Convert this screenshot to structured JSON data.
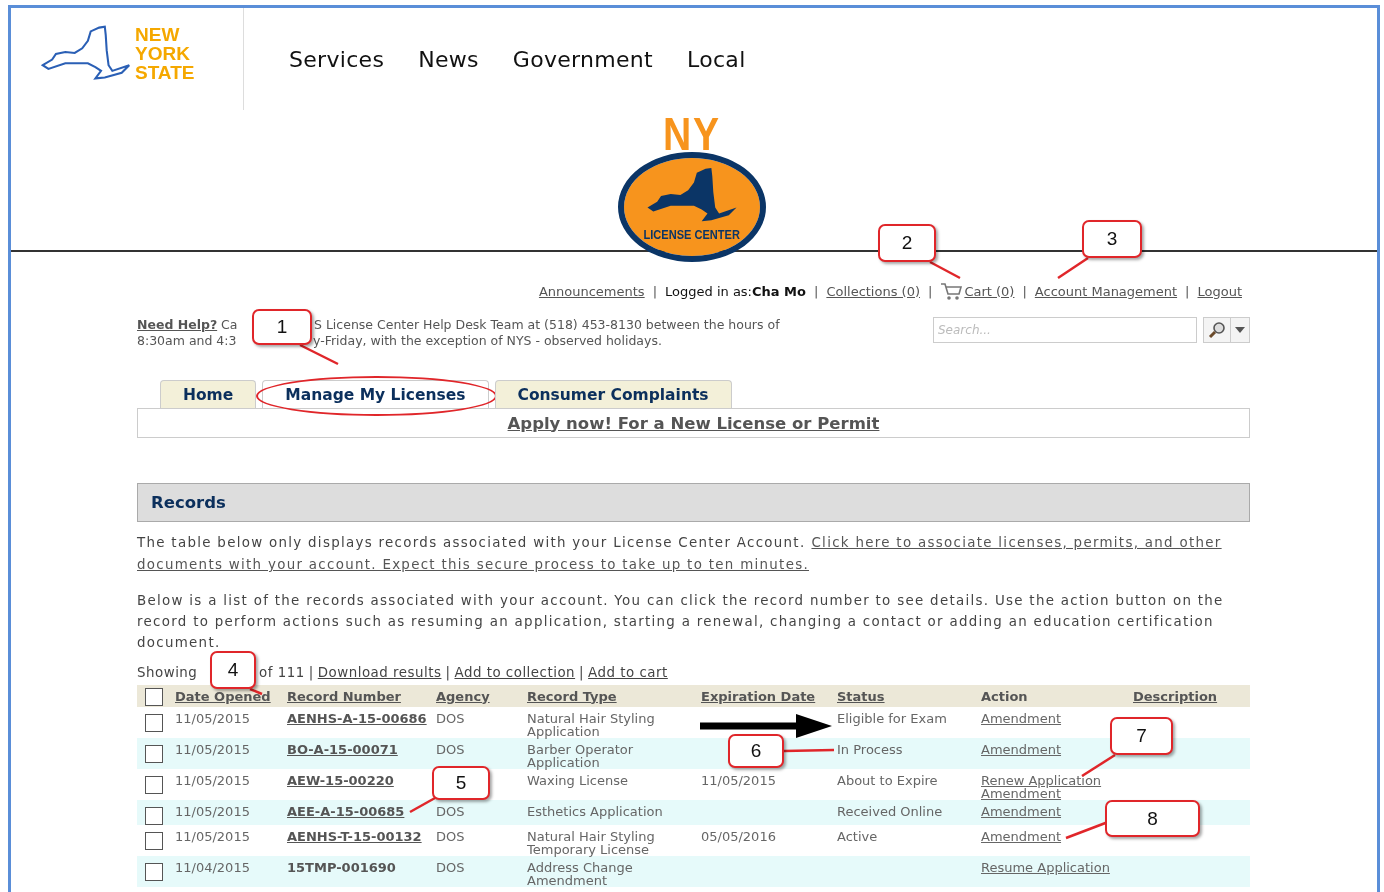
{
  "header": {
    "logo_text": [
      "NEW",
      "YORK",
      "STATE"
    ],
    "nav": [
      {
        "label": "Services"
      },
      {
        "label": "News"
      },
      {
        "label": "Government"
      },
      {
        "label": "Local"
      }
    ]
  },
  "banner": {
    "logo_top": "NY",
    "logo_bottom": "LICENSE CENTER"
  },
  "top_links": [
    {
      "kind": "link",
      "label": "Announcements"
    },
    {
      "kind": "user",
      "prefix": "Logged in as:",
      "name": "Cha Mo"
    },
    {
      "kind": "link",
      "label": "Collections (0)"
    },
    {
      "kind": "cart",
      "label": "Cart (0)"
    },
    {
      "kind": "link",
      "label": "Account Management"
    },
    {
      "kind": "link",
      "label": "Logout"
    }
  ],
  "top_separator": "|",
  "help": {
    "link": "Need Help?",
    "line1_start": "Ca",
    "line1_end": "S License Center Help Desk Team at (518) 453-8130 between the hours of",
    "line2_start": "8:30am and 4:3",
    "line2_end": "y-Friday, with the exception of NYS - observed holidays."
  },
  "search": {
    "placeholder": "Search..."
  },
  "tabs": [
    {
      "label": "Home",
      "selected": false,
      "circled": false
    },
    {
      "label": "Manage My Licenses",
      "selected": true,
      "circled": true
    },
    {
      "label": "Consumer Complaints",
      "selected": false,
      "circled": false
    }
  ],
  "apply_link": "Apply now! For a New License or Permit",
  "records": {
    "title": "Records",
    "intro": "The table below only displays records associated with your License Center Account.",
    "intro_link": [
      "Click here to associate licenses, permits, and other",
      "documents with your account. Expect this secure process to take up to ten minutes."
    ],
    "description": "Below is a list of the records associated with your account. You can click the record number to see details. Use the action button on the record to perform actions such as resuming an application, starting a renewal, changing a contact or adding an education certification document.",
    "showing_start": "Showing",
    "showing_end": "of 111",
    "separator": "|",
    "actions": [
      "Download results",
      "Add to collection",
      "Add to cart"
    ],
    "select_all_checked": false,
    "columns": [
      {
        "label": "Date Opened",
        "sortable": true
      },
      {
        "label": "Record Number",
        "sortable": true
      },
      {
        "label": "Agency",
        "sortable": true
      },
      {
        "label": "Record Type",
        "sortable": true
      },
      {
        "label": "Expiration Date",
        "sortable": true
      },
      {
        "label": "Status",
        "sortable": true
      },
      {
        "label": "Action",
        "sortable": false
      },
      {
        "label": "Description",
        "sortable": true
      }
    ],
    "rows": [
      {
        "checked": false,
        "date": "11/05/2015",
        "record": "AENHS-A-15-00686",
        "linked": true,
        "agency": "DOS",
        "type": "Natural Hair Styling Application",
        "status": "Eligible for Exam",
        "actions": [
          "Amendment"
        ]
      },
      {
        "checked": false,
        "date": "11/05/2015",
        "record": "BO-A-15-00071",
        "linked": true,
        "agency": "DOS",
        "type": "Barber Operator Application",
        "status": "In Process",
        "actions": [
          "Amendment"
        ]
      },
      {
        "checked": false,
        "date": "11/05/2015",
        "record": "AEW-15-00220",
        "linked": true,
        "type": "Waxing License",
        "expiration": "11/05/2015",
        "status": "About to Expire",
        "actions": [
          "Renew Application",
          "Amendment"
        ]
      },
      {
        "checked": false,
        "date": "11/05/2015",
        "record": "AEE-A-15-00685",
        "linked": true,
        "agency": "DOS",
        "type": "Esthetics Application",
        "status": "Received Online",
        "actions": [
          "Amendment"
        ]
      },
      {
        "checked": false,
        "date": "11/05/2015",
        "record": "AENHS-T-15-00132",
        "linked": true,
        "agency": "DOS",
        "type": "Natural Hair Styling Temporary License",
        "expiration": "05/05/2016",
        "status": "Active",
        "actions": [
          "Amendment"
        ]
      },
      {
        "checked": false,
        "date": "11/04/2015",
        "record": "15TMP-001690",
        "linked": false,
        "agency": "DOS",
        "type": "Address Change Amendment",
        "actions": [
          "Resume Application"
        ]
      }
    ]
  },
  "callouts": [
    {
      "label": "1"
    },
    {
      "label": "2"
    },
    {
      "label": "3"
    },
    {
      "label": "4"
    },
    {
      "label": "5"
    },
    {
      "label": "6"
    },
    {
      "label": "7"
    },
    {
      "label": "8"
    }
  ]
}
